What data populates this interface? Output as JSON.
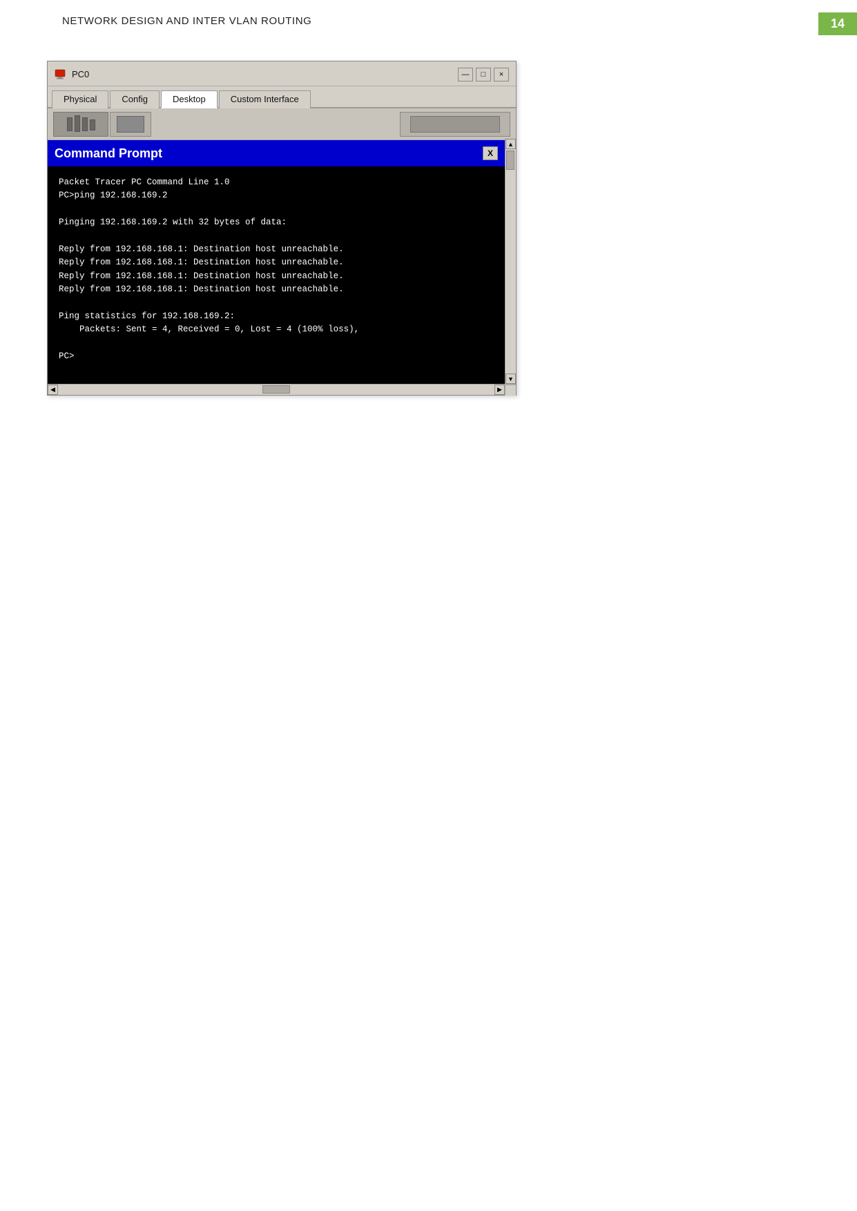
{
  "page": {
    "title": "NETWORK DESIGN AND INTER VLAN ROUTING",
    "number": "14"
  },
  "window": {
    "title": "PC0",
    "tabs": [
      {
        "label": "Physical",
        "active": false
      },
      {
        "label": "Config",
        "active": false
      },
      {
        "label": "Desktop",
        "active": true
      },
      {
        "label": "Custom Interface",
        "active": false
      }
    ],
    "controls": {
      "minimize": "—",
      "maximize": "□",
      "close": "×"
    }
  },
  "command_prompt": {
    "title": "Command Prompt",
    "close_btn": "X",
    "content": "Packet Tracer PC Command Line 1.0\nPC>ping 192.168.169.2\n\nPinging 192.168.169.2 with 32 bytes of data:\n\nReply from 192.168.168.1: Destination host unreachable.\nReply from 192.168.168.1: Destination host unreachable.\nReply from 192.168.168.1: Destination host unreachable.\nReply from 192.168.168.1: Destination host unreachable.\n\nPing statistics for 192.168.169.2:\n    Packets: Sent = 4, Received = 0, Lost = 4 (100% loss),\n\nPC>"
  }
}
